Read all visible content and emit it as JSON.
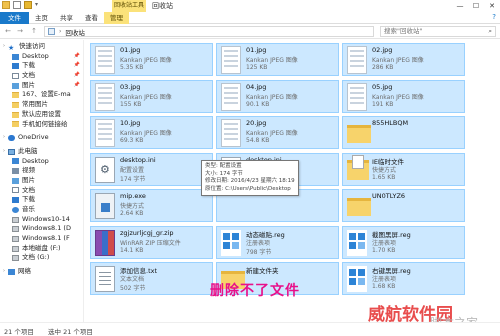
{
  "window": {
    "title": "回收站",
    "context_tab": "回收站工具",
    "controls": [
      "—",
      "☐",
      "✕"
    ]
  },
  "ribbon": {
    "tabs": [
      "文件",
      "主页",
      "共享",
      "查看",
      "管理"
    ],
    "help": "?"
  },
  "address": {
    "back": "←",
    "forward": "→",
    "up": "↑",
    "path_root": "›",
    "path": "回收站",
    "search_placeholder": "搜索\"回收站\""
  },
  "sidebar": {
    "items": [
      {
        "label": "快速访问",
        "icon": "star-icon",
        "pinned": false,
        "level": 0
      },
      {
        "label": "Desktop",
        "icon": "desktop-icon",
        "pinned": true,
        "level": 1
      },
      {
        "label": "下载",
        "icon": "download-icon",
        "pinned": true,
        "level": 1
      },
      {
        "label": "文档",
        "icon": "document-icon",
        "pinned": true,
        "level": 1
      },
      {
        "label": "图片",
        "icon": "picture-icon",
        "pinned": true,
        "level": 1
      },
      {
        "label": "167、设置E-ma",
        "icon": "folder-icon",
        "pinned": false,
        "level": 1
      },
      {
        "label": "常用图片",
        "icon": "folder-icon",
        "pinned": false,
        "level": 1
      },
      {
        "label": "默认应用设置",
        "icon": "folder-icon",
        "pinned": false,
        "level": 1
      },
      {
        "label": "手机如何链接给",
        "icon": "folder-icon",
        "pinned": false,
        "level": 1
      },
      {
        "label": "OneDrive",
        "icon": "cloud-icon",
        "pinned": false,
        "level": 0
      },
      {
        "label": "此电脑",
        "icon": "computer-icon",
        "pinned": false,
        "level": 0
      },
      {
        "label": "Desktop",
        "icon": "desktop-icon",
        "pinned": false,
        "level": 1
      },
      {
        "label": "视频",
        "icon": "video-icon",
        "pinned": false,
        "level": 1
      },
      {
        "label": "图片",
        "icon": "picture-icon",
        "pinned": false,
        "level": 1
      },
      {
        "label": "文档",
        "icon": "document-icon",
        "pinned": false,
        "level": 1
      },
      {
        "label": "下载",
        "icon": "download-icon",
        "pinned": false,
        "level": 1
      },
      {
        "label": "音乐",
        "icon": "music-icon",
        "pinned": false,
        "level": 1
      },
      {
        "label": "Windows10-14",
        "icon": "drive-icon",
        "pinned": false,
        "level": 1
      },
      {
        "label": "Windows8.1 (D",
        "icon": "drive-icon",
        "pinned": false,
        "level": 1
      },
      {
        "label": "Windows8.1 (F",
        "icon": "drive-icon",
        "pinned": false,
        "level": 1
      },
      {
        "label": "本地磁盘 (F:)",
        "icon": "drive-icon",
        "pinned": false,
        "level": 1
      },
      {
        "label": "文档 (G:)",
        "icon": "drive-icon",
        "pinned": false,
        "level": 1
      },
      {
        "label": "网络",
        "icon": "network-icon",
        "pinned": false,
        "level": 0
      }
    ]
  },
  "files": [
    {
      "name": "01.jpg",
      "type": "Kankan JPEG 图像",
      "size": "5.35 KB",
      "kind": "thumb",
      "selected": true
    },
    {
      "name": "01.jpg",
      "type": "Kankan JPEG 图像",
      "size": "125 KB",
      "kind": "thumb",
      "selected": true
    },
    {
      "name": "02.jpg",
      "type": "Kankan JPEG 图像",
      "size": "286 KB",
      "kind": "thumb",
      "selected": true
    },
    {
      "name": "03.jpg",
      "type": "Kankan JPEG 图像",
      "size": "155 KB",
      "kind": "thumb",
      "selected": true
    },
    {
      "name": "04.jpg",
      "type": "Kankan JPEG 图像",
      "size": "90.1 KB",
      "kind": "thumb",
      "selected": true
    },
    {
      "name": "05.jpg",
      "type": "Kankan JPEG 图像",
      "size": "191 KB",
      "kind": "thumb",
      "selected": true
    },
    {
      "name": "10.jpg",
      "type": "Kankan JPEG 图像",
      "size": "69.3 KB",
      "kind": "thumb",
      "selected": true
    },
    {
      "name": "20.jpg",
      "type": "Kankan JPEG 图像",
      "size": "54.8 KB",
      "kind": "thumb",
      "selected": true
    },
    {
      "name": "855HLBQM",
      "type": "",
      "size": "",
      "kind": "folder",
      "selected": true
    },
    {
      "name": "desktop.ini",
      "type": "配置设置",
      "size": "174 字节",
      "kind": "gear",
      "selected": true
    },
    {
      "name": "desktop.ini",
      "type": "配置设置",
      "size": "",
      "kind": "gear",
      "selected": true
    },
    {
      "name": "IE临时文件",
      "type": "快捷方式",
      "size": "1.65 KB",
      "kind": "folderdoc",
      "selected": true
    },
    {
      "name": "mip.exe",
      "type": "快捷方式",
      "size": "2.64 KB",
      "kind": "exe",
      "selected": true
    },
    {
      "name": "",
      "type": "",
      "size": "",
      "kind": "none",
      "selected": true
    },
    {
      "name": "UN0TLYZ6",
      "type": "",
      "size": "",
      "kind": "folder",
      "selected": true
    },
    {
      "name": "zgjzurljcgj_gr.zip",
      "type": "WinRAR ZIP 压缩文件",
      "size": "14.1 KB",
      "kind": "zip",
      "selected": true
    },
    {
      "name": "动态磁贴.reg",
      "type": "注册表项",
      "size": "798 字节",
      "kind": "reg",
      "selected": true
    },
    {
      "name": "截图黑屏.reg",
      "type": "注册表项",
      "size": "1.70 KB",
      "kind": "reg",
      "selected": true
    },
    {
      "name": "添加信息.txt",
      "type": "文本文档",
      "size": "502 字节",
      "kind": "txt",
      "selected": true
    },
    {
      "name": "新建文件夹",
      "type": "",
      "size": "",
      "kind": "folder",
      "selected": true
    },
    {
      "name": "右键黑屏.reg",
      "type": "注册表项",
      "size": "1.68 KB",
      "kind": "reg",
      "selected": true
    }
  ],
  "tooltip": {
    "lines": [
      "类型: 配置设置",
      "大小: 174 字节",
      "修改日期: 2016/4/23 星期六 18:19",
      "原位置: C:\\Users\\Public\\Desktop"
    ]
  },
  "caption": "删除不了文件",
  "watermark": "威航软件园",
  "watermark_sub": "脚本之家",
  "status": {
    "left": "21 个项目",
    "selected": "选中 21 个项目"
  },
  "colors": {
    "accent": "#1979ca",
    "manage_tab": "#fbe27a",
    "selection": "#cce8ff",
    "caption": "#e8108a",
    "watermark": "#e63a3a"
  }
}
